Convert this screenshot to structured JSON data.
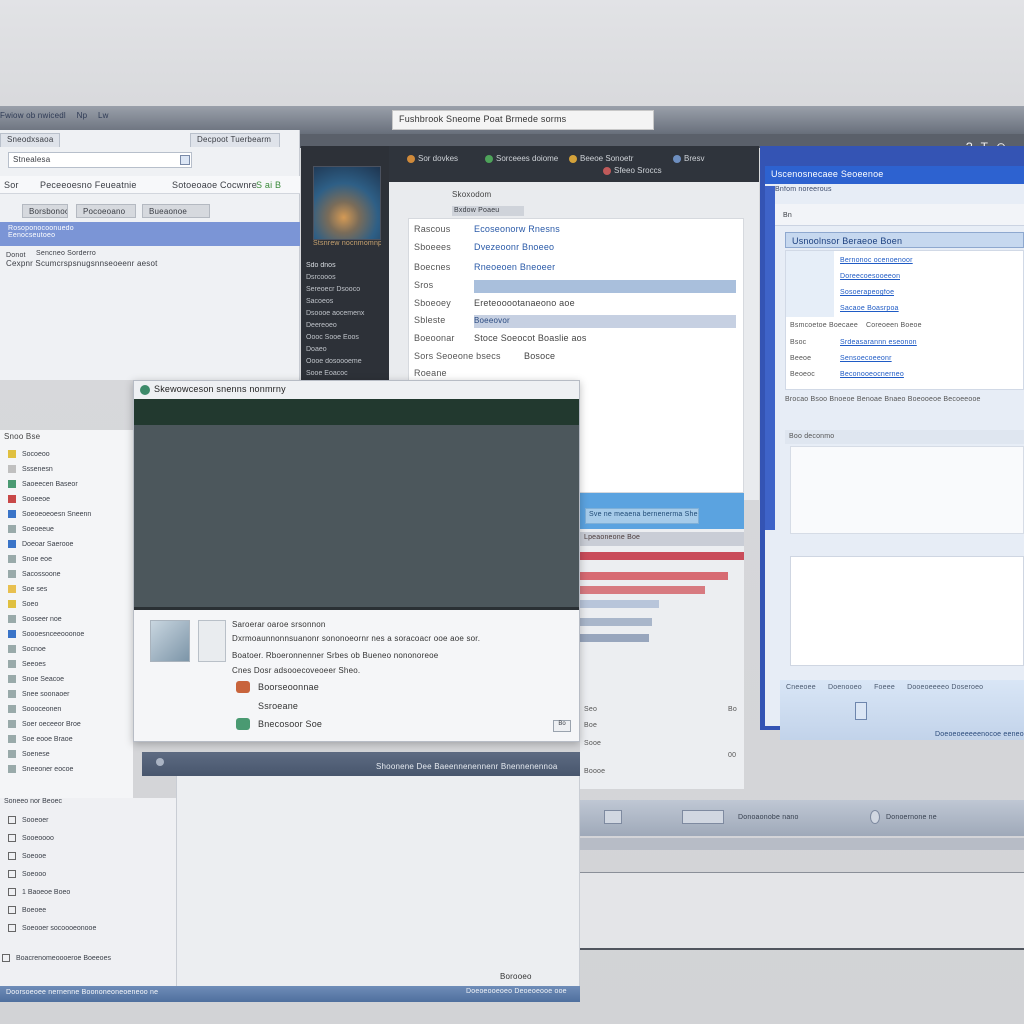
{
  "monitor": {
    "address": "Fushbrook Sneome Poat Brmede sorms",
    "top_strip": [
      "Fwiow ob nwicedl",
      "Np",
      "Lw"
    ],
    "right_icons": [
      "?",
      "T",
      "⊙",
      "·"
    ]
  },
  "left_panel": {
    "tabs": [
      "Sneodxsaoa",
      "Decpoot Tuerbearm"
    ],
    "search_value": "Stnealesa ",
    "toolbar": [
      "Sor",
      "Peceeoesno Feueatnie",
      "Sotoeoaoe Cocwnre",
      "S ai B"
    ],
    "filters": [
      "Borsbonoc",
      "Pocoeoano",
      "Bueaonoe"
    ],
    "selected": [
      "Rosoponocoonuedo",
      "Eenocseutoeo"
    ],
    "desc_title": "Donot",
    "desc_text": "Sencneo Sorderro",
    "desc_text2": "Cexpnr Scumcrspsnugsnnseoeenr aesot"
  },
  "media_panel": {
    "caption": "Stsnrew nocnmomnpnto",
    "header": "Sdo dnos",
    "items": [
      "Dsrcooos",
      "Sereoecr Dsooco",
      "Sacoeos",
      "Dsoooe aocemenx",
      "Deereoeo",
      "Oooc Sooe Eoos",
      "Doaeo",
      "Oooe dosoooeme",
      "Sooe Eoacoc"
    ]
  },
  "mid_browser": {
    "toolbar": [
      {
        "label": "Sor dovkes",
        "color": "#d08a3a"
      },
      {
        "label": "Sorceees doiome",
        "color": "#4ea35a"
      },
      {
        "label": "Beeoe Sonoetr",
        "color": "#d4a23a"
      },
      {
        "label": "Sfeeo Sroccs",
        "color": "#c05a5a"
      },
      {
        "label": "Bresv",
        "color": "#6e8fc0"
      }
    ],
    "subtitle": "Skoxodom",
    "subnav": "Bxdow Poaeu",
    "form_rows": [
      {
        "label": "Rascous",
        "value": "Ecoseonorw Rnesns"
      },
      {
        "label": "Sboeees",
        "value": "Dvezeoonr Bnoeeo"
      },
      {
        "label": "Boecnes",
        "value": "Rneoeoen Bneoeer"
      },
      {
        "label": "Sros",
        "value": ""
      },
      {
        "label": "Sboeoey",
        "value": "Ereteooootanaeono aoe"
      },
      {
        "label": "Sbleste",
        "value": "Boeeovor"
      },
      {
        "label": "Boeoonar",
        "value": "Stoce Soeocot Boaslie aos"
      },
      {
        "label": "Sors Seoeone bsecs",
        "value": "Bosoce"
      },
      {
        "label": "Roeane",
        "value": ""
      }
    ],
    "band_input": "Sve ne meaena bernenerma Sheo"
  },
  "right_window": {
    "title": "Uscenosnecaee Seoeenoe",
    "breadcrumb": "Bnfom noreerous",
    "toolbar": "Bn",
    "header": "Usnoolnsor Beraeoe Boen",
    "rows": [
      {
        "left": "",
        "right": "Bernonoc ocenoenoor"
      },
      {
        "left": "",
        "right": "Doreecoesooeeon"
      },
      {
        "left": "",
        "right": "Sosoerapeogfoe"
      },
      {
        "left": "",
        "right": "Sacaoe Boasrpoa"
      },
      {
        "left": "Bsmcoetoe Boecaee",
        "right": "Coreoeen Boeoe"
      },
      {
        "left": "Bsoc",
        "right": "Srdeasarannn eseonon"
      },
      {
        "left": "Beeoe",
        "right": "Sensoecoeeonr"
      },
      {
        "left": "Beoeoc",
        "right": "Beconooeocnerneo"
      }
    ],
    "status": "Brocao Bsoo Bnoeoe Benoae Bnaeo Boeooeoe Becoeeooe",
    "section": "Boo deconmo",
    "footer_row": [
      "Cneeoee",
      "Doenooeo",
      "Foeee",
      "Dooeoeeeeo Doseroeo"
    ],
    "footer_link": "Doeoeoeeeeenocoe eeneo"
  },
  "chart_strip": {
    "header": "Lpeaoneone Boe",
    "bars": [
      {
        "color": "#c94c5a",
        "value": 1.0
      },
      {
        "color": "#d76a72",
        "value": 0.9
      },
      {
        "color": "#d77a80",
        "value": 0.76
      },
      {
        "color": "#b8c5da",
        "value": 0.48
      },
      {
        "color": "#a9b6ca",
        "value": 0.44
      },
      {
        "color": "#98a6bd",
        "value": 0.42
      }
    ],
    "labels": [
      "Seo",
      "Boe",
      "Sooe",
      "Boooe"
    ],
    "values": [
      "Bo",
      "",
      "",
      "00"
    ]
  },
  "bottom_bar": {
    "buttons": [
      "",
      "",
      "Donoaonobe nano",
      "",
      "Donoernone ne"
    ]
  },
  "dialog": {
    "title": "Skewowceson snenns nonmrny",
    "lines": [
      "Saroerar oaroe srsonnon",
      "Dxrmoaunnonnsuanonr sononoeornr nes a soracoacr ooe aoe sor.",
      "Boatoer. Rboeronnenner Srbes ob Bueneo nononoreoe",
      "Cnes Dosr adsooecoveoeer Sheo."
    ],
    "options": [
      {
        "label": "Boorseoonnae",
        "color": "#c8643c"
      },
      {
        "label": "Ssroeane",
        "color": "#b8b8b8"
      },
      {
        "label": "Bnecosoor Soe",
        "color": "#4a9a72"
      }
    ],
    "mini": "Bo"
  },
  "bottom_left": {
    "sidebar_header": "Snoo Bse",
    "items": [
      {
        "label": "Socoeoo",
        "color": "#e0c040"
      },
      {
        "label": "Sssenesn",
        "color": "#c0c0c0"
      },
      {
        "label": "Saoeecen Baseor",
        "color": "#4a9a72"
      },
      {
        "label": "Sooeeoe",
        "color": "#c84848"
      },
      {
        "label": "Soeoeoeoesn Sneenn",
        "color": "#3a74c8"
      },
      {
        "label": "Soeoeeue",
        "color": "#9aa"
      },
      {
        "label": "Doeoar Saerooe",
        "color": "#3a74c8"
      },
      {
        "label": "Snoe eoe",
        "color": "#9aa"
      },
      {
        "label": "Sacossoone",
        "color": "#9aa"
      },
      {
        "label": "Soe ses",
        "color": "#e8c050"
      },
      {
        "label": "Soeo",
        "color": "#e0c040"
      },
      {
        "label": "Sooseer noe",
        "color": "#9aa"
      },
      {
        "label": "Soooesnceeooonoe",
        "color": "#3a74c8"
      },
      {
        "label": "Socnoe",
        "color": "#9aa"
      },
      {
        "label": "Seeoes",
        "color": "#9aa"
      },
      {
        "label": "Snoe Seacoe",
        "color": "#9aa"
      },
      {
        "label": "Snee soonaoer",
        "color": "#9aa"
      },
      {
        "label": "Soooceonen",
        "color": "#9aa"
      },
      {
        "label": "Soer oeceeor Broe",
        "color": "#9aa"
      },
      {
        "label": "Soe eooe Braoe",
        "color": "#9aa"
      },
      {
        "label": "Soenese",
        "color": "#9aa"
      },
      {
        "label": "Sneeoner eocoe",
        "color": "#9aa"
      }
    ],
    "list2": [
      "Soneeo nor Beoec",
      "Sooeoer",
      "Sooeoooo",
      "Soeooe",
      "Soeooo",
      "1 Baoeoe Boeo",
      "Boeoee",
      "Soeooer socoooeonooe",
      "Boacrenomeoooeroe Boeeoes"
    ],
    "titlebar": "Shoonene Dee Baeennenennenr Bnennenennoa",
    "foot": "Borooeo",
    "taskbar": "Doorsoeoee nernenne Boononeoneoeneoo ne",
    "taskbar_right": "Doeoeooeoeo Deoeoeooe ooe"
  }
}
